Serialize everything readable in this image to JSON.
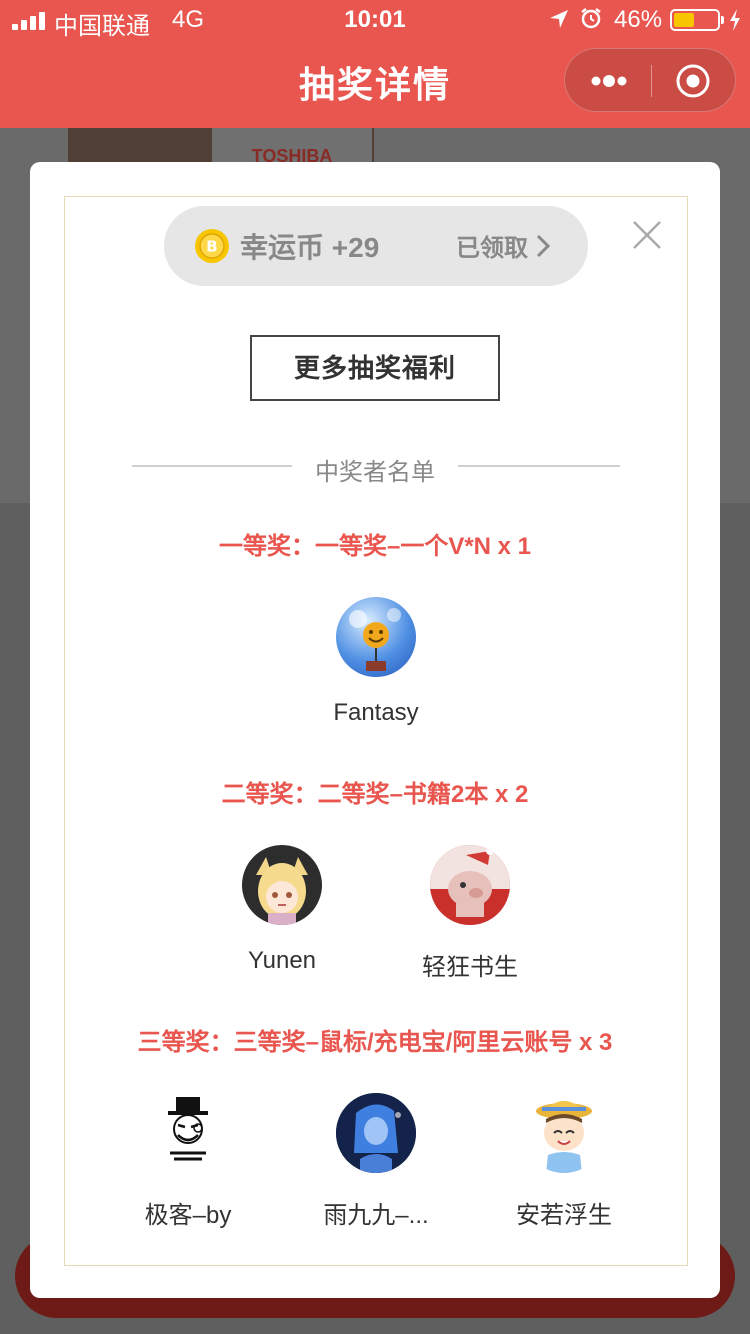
{
  "status_bar": {
    "carrier": "中国联通",
    "network": "4G",
    "time": "10:01",
    "battery": "46%"
  },
  "nav": {
    "title": "抽奖详情"
  },
  "background": {
    "product_brand": "TOSHIBA"
  },
  "modal": {
    "coin_label": "幸运币 +29",
    "coin_status": "已领取",
    "more_button": "更多抽奖福利",
    "section_title": "中奖者名单",
    "prizes": [
      {
        "title": "一等奖：一等奖–一个V*N x 1",
        "winners": [
          {
            "name": "Fantasy"
          }
        ]
      },
      {
        "title": "二等奖：二等奖–书籍2本 x 2",
        "winners": [
          {
            "name": "Yunen"
          },
          {
            "name": "轻狂书生"
          }
        ]
      },
      {
        "title": "三等奖：三等奖–鼠标/充电宝/阿里云账号 x 3",
        "winners": [
          {
            "name": "极客–by"
          },
          {
            "name": "雨九九–..."
          },
          {
            "name": "安若浮生"
          }
        ]
      }
    ]
  },
  "colors": {
    "brand_red": "#e8564f",
    "coin_gold": "#f7c600",
    "border_gold": "#e5d9b6"
  },
  "icons": [
    "signal-icon",
    "location-arrow-icon",
    "alarm-clock-icon",
    "battery-icon",
    "charging-bolt-icon",
    "more-dots-icon",
    "close-target-icon",
    "coin-icon",
    "chevron-right-icon",
    "close-icon"
  ]
}
